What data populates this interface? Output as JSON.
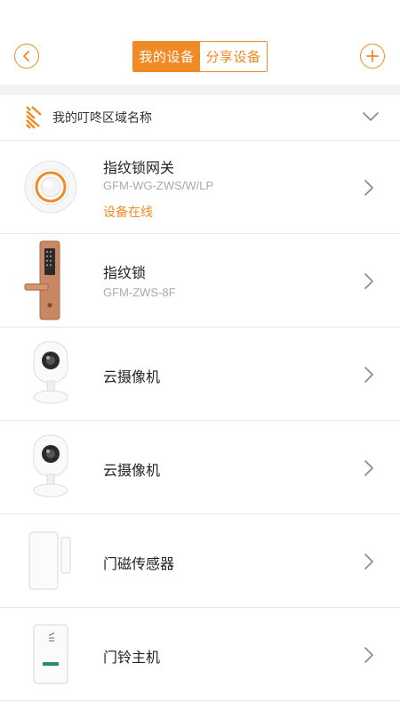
{
  "header": {
    "tabs": [
      {
        "label": "我的设备",
        "active": true
      },
      {
        "label": "分享设备",
        "active": false
      }
    ],
    "back_icon": "back-circle-icon",
    "add_icon": "add-circle-icon"
  },
  "area": {
    "name": "我的叮咚区域名称",
    "logo_icon": "brand-stripes-icon",
    "expand_icon": "chevron-down-icon"
  },
  "devices": [
    {
      "name": "指纹锁网关",
      "model": "GFM-WG-ZWS/W/LP",
      "status": "设备在线",
      "icon": "gateway-icon"
    },
    {
      "name": "指纹锁",
      "model": "GFM-ZWS-8F",
      "status": "",
      "icon": "fingerprint-lock-icon"
    },
    {
      "name": "云摄像机",
      "model": "",
      "status": "",
      "icon": "cloud-camera-icon"
    },
    {
      "name": "云摄像机",
      "model": "",
      "status": "",
      "icon": "cloud-camera-icon"
    },
    {
      "name": "门磁传感器",
      "model": "",
      "status": "",
      "icon": "door-sensor-icon"
    },
    {
      "name": "门铃主机",
      "model": "",
      "status": "",
      "icon": "doorbell-host-icon"
    }
  ],
  "colors": {
    "accent": "#f08a24",
    "divider": "#e6e6e6",
    "gap": "#f2f2f2"
  }
}
